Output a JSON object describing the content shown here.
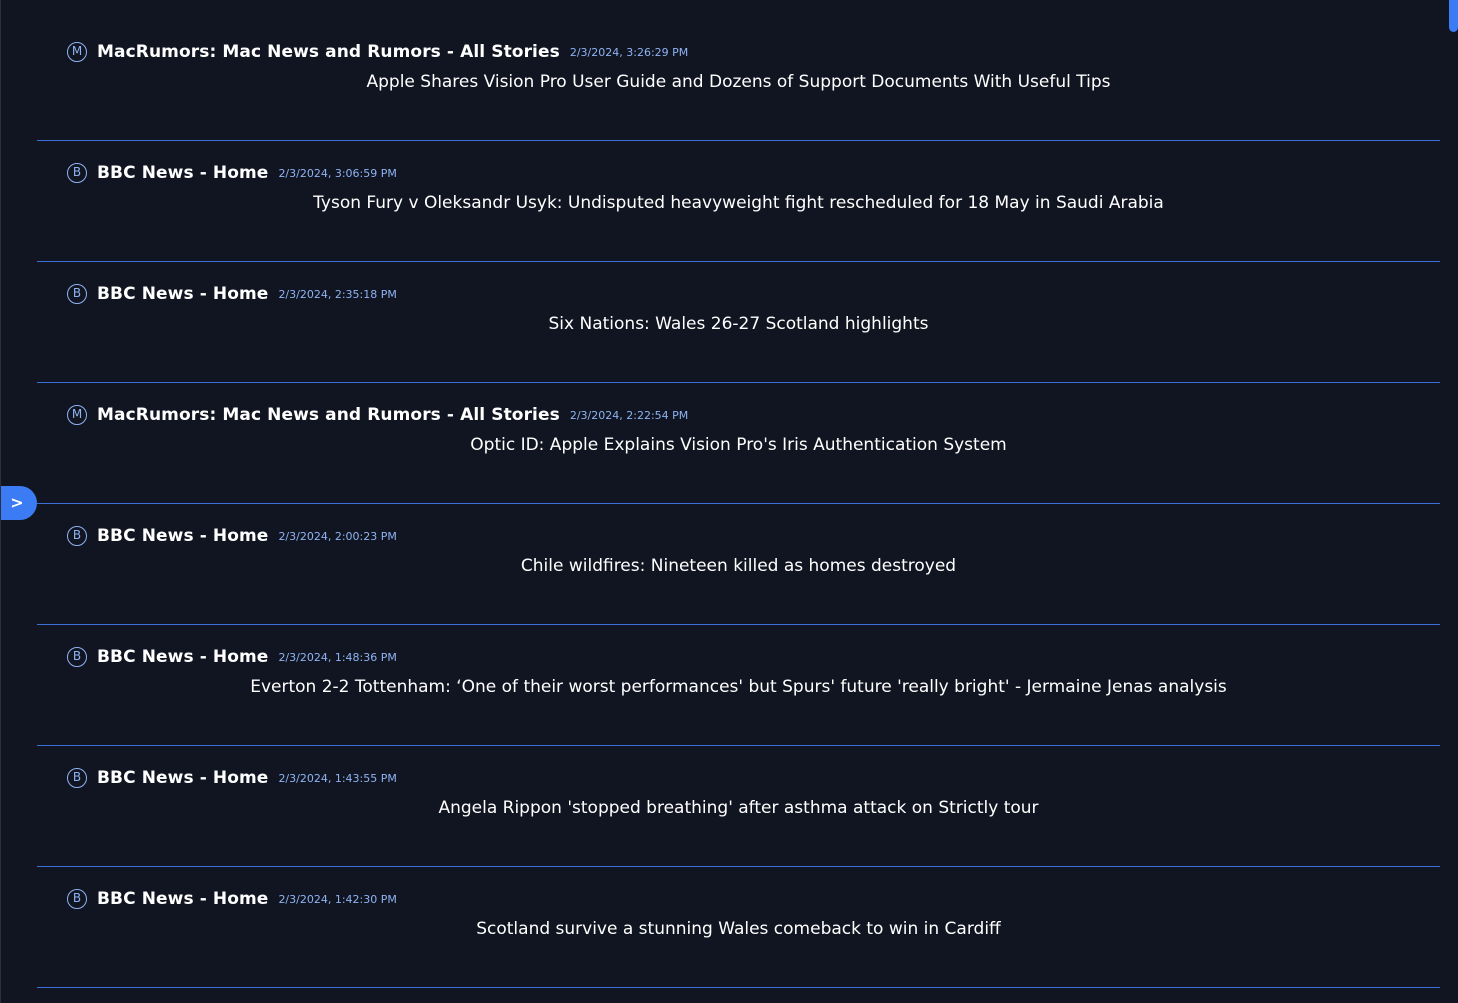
{
  "sidebar_toggle": {
    "label": ">"
  },
  "feed": {
    "items": [
      {
        "source_initial": "M",
        "source": "MacRumors: Mac News and Rumors - All Stories",
        "time": "2/3/2024, 3:26:29 PM",
        "title": "Apple Shares Vision Pro User Guide and Dozens of Support Documents With Useful Tips"
      },
      {
        "source_initial": "B",
        "source": "BBC News - Home",
        "time": "2/3/2024, 3:06:59 PM",
        "title": "Tyson Fury v Oleksandr Usyk: Undisputed heavyweight fight rescheduled for 18 May in Saudi Arabia"
      },
      {
        "source_initial": "B",
        "source": "BBC News - Home",
        "time": "2/3/2024, 2:35:18 PM",
        "title": "Six Nations: Wales 26-27 Scotland highlights"
      },
      {
        "source_initial": "M",
        "source": "MacRumors: Mac News and Rumors - All Stories",
        "time": "2/3/2024, 2:22:54 PM",
        "title": "Optic ID: Apple Explains Vision Pro's Iris Authentication System"
      },
      {
        "source_initial": "B",
        "source": "BBC News - Home",
        "time": "2/3/2024, 2:00:23 PM",
        "title": "Chile wildfires: Nineteen killed as homes destroyed"
      },
      {
        "source_initial": "B",
        "source": "BBC News - Home",
        "time": "2/3/2024, 1:48:36 PM",
        "title": "Everton 2-2 Tottenham: ‘One of their worst performances' but Spurs' future 'really bright' - Jermaine Jenas analysis"
      },
      {
        "source_initial": "B",
        "source": "BBC News - Home",
        "time": "2/3/2024, 1:43:55 PM",
        "title": "Angela Rippon 'stopped breathing' after asthma attack on Strictly tour"
      },
      {
        "source_initial": "B",
        "source": "BBC News - Home",
        "time": "2/3/2024, 1:42:30 PM",
        "title": "Scotland survive a stunning Wales comeback to win in Cardiff"
      }
    ]
  }
}
